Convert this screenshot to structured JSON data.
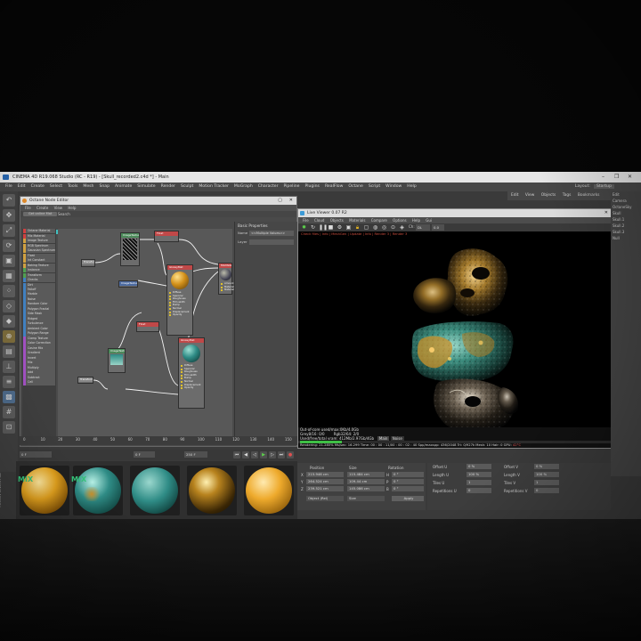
{
  "window": {
    "title": "CINEMA 4D R19.068 Studio (RC - R19) - [Skull_recorded2.c4d *] - Main",
    "controls": [
      "–",
      "❐",
      "✕"
    ]
  },
  "menubar": {
    "items": [
      "File",
      "Edit",
      "Create",
      "Select",
      "Tools",
      "Mesh",
      "Snap",
      "Animate",
      "Simulate",
      "Render",
      "Sculpt",
      "Motion Tracker",
      "MoGraph",
      "Character",
      "Pipeline",
      "Plugins",
      "RealFlow",
      "Octane",
      "Script",
      "Window",
      "Help"
    ],
    "layout_label": "Layout:",
    "layout_value": "Startup"
  },
  "node_editor": {
    "title": "Octane Node Editor",
    "menu": [
      "File",
      "Create",
      "View",
      "Help"
    ],
    "button": "Get online Mat",
    "search_label": "Search",
    "node_list": [
      "Octane Material",
      "Mix Material",
      "Image Texture",
      "RGB Spectrum",
      "Gaussian Spectrum",
      "Float",
      "Int Constant",
      "Baking Texture",
      "Instance",
      "Transform",
      "Checks",
      "Dirt",
      "Falloff",
      "Marble",
      "Noise",
      "Random Color",
      "Polygon Fractal",
      "Side Mask",
      "Ridged",
      "Turbulence",
      "Ambient Color",
      "Polygon Range",
      "Clamp Texture",
      "Color Correction",
      "Cosine Mix",
      "Gradient",
      "Invert",
      "Mix",
      "Multiply",
      "Add",
      "Subtract",
      "Cell"
    ],
    "properties": {
      "header": "Basic Properties",
      "name_label": "Name",
      "name_value": "<<Multiple Values>>",
      "layer_label": "Layer"
    },
    "nodes": {
      "image_a": "ImageTexture",
      "transform": "Transform",
      "image_b": "ImageTexture",
      "mix_material": "MixMaterial",
      "glossy_a": "GlossyMat",
      "float_a": "Float",
      "glossy_b": "GlossyMat",
      "float_b": "Float",
      "image_c": "ImageTexture",
      "ports": [
        "Diffuse",
        "Specular",
        "Roughness",
        "Film width",
        "Bump",
        "Normal",
        "Displacement",
        "Opacity"
      ],
      "mix_ports": [
        "Amount",
        "Material1",
        "Material2"
      ]
    }
  },
  "live_viewer": {
    "title": "Live Viewer 0.07 R2",
    "menu": [
      "File",
      "Cloud",
      "Objects",
      "Materials",
      "Compare",
      "Options",
      "Help",
      "Gui"
    ],
    "info_line": "Check files | Info | MeshGen | Update | Info | Render 3 | Render 3",
    "mode": "DL",
    "value": "0.0",
    "overlay_line": "Out-of-core used/max:0Kb/4.0Gb",
    "gray_line": "Grey8/16: 0/0",
    "rgb_line": "Rgb32/64: 2/0",
    "mem_line": "Used/free/total vram: 412Mb/2.97Gb/4Gb",
    "tabs": [
      "Main",
      "Noise"
    ],
    "status_line": "Rendering: 21.285%  Ms/sec: 16.299  Time: 00 : 00 : 11/00 : 00 : 02 : 40  Spp/maxspp: 436/2048  Tri: 0/927k  Mesh: 10  Hair: 0  GPU:",
    "gpu_temp": "42°C"
  },
  "right_panel": {
    "menu": [
      "Edit",
      "View",
      "Objects",
      "Tags",
      "Bookmarks"
    ],
    "items": [
      "Camera",
      "OctaneSky",
      "Skull",
      "Skull.1",
      "Skull.2",
      "Skull.3",
      "Null"
    ]
  },
  "timeline": {
    "ticks": [
      "0",
      "10",
      "20",
      "30",
      "40",
      "50",
      "60",
      "70",
      "80",
      "90",
      "100",
      "110",
      "120",
      "130",
      "140",
      "150"
    ],
    "start_frame": "0 F",
    "current_frame": "0 F",
    "end_frame": "250 F",
    "end_frame2": "250 F"
  },
  "coordinates": {
    "header_position": "Position",
    "header_size": "Size",
    "header_rotation": "Rotation",
    "rows": [
      {
        "axis": "X",
        "pos": "215.946 cm",
        "size": "115.484 cm",
        "rot_axis": "H",
        "rot": "0 °"
      },
      {
        "axis": "Y",
        "pos": "264.524 cm",
        "size": "109.44 cm",
        "rot_axis": "P",
        "rot": "0 °"
      },
      {
        "axis": "Z",
        "pos": "239.521 cm",
        "size": "145.086 cm",
        "rot_axis": "B",
        "rot": "0 °"
      }
    ],
    "mode": "Object (Rel)",
    "size_mode": "Size",
    "apply": "Apply"
  },
  "attributes": {
    "offset_u": "Offset U",
    "offset_u_val": "0 %",
    "offset_v": "Offset V",
    "offset_v_val": "0 %",
    "length_u": "Length U",
    "length_u_val": "100 %",
    "length_v": "Length V",
    "length_v_val": "100 %",
    "tiles_u": "Tiles U",
    "tiles_u_val": "1",
    "tiles_v": "Tiles V",
    "tiles_v_val": "1",
    "rep_u": "Repetitions U",
    "rep_u_val": "0",
    "rep_v": "Repetitions V",
    "rep_v_val": "0"
  },
  "materials": {
    "mix_label": "MIX",
    "side_label": "MAXON CINEMA 4D"
  },
  "colors": {
    "accent_green": "#35c47a",
    "gold": "#e3a21e",
    "teal": "#2f8c86",
    "warning_red": "#c84c3c"
  }
}
